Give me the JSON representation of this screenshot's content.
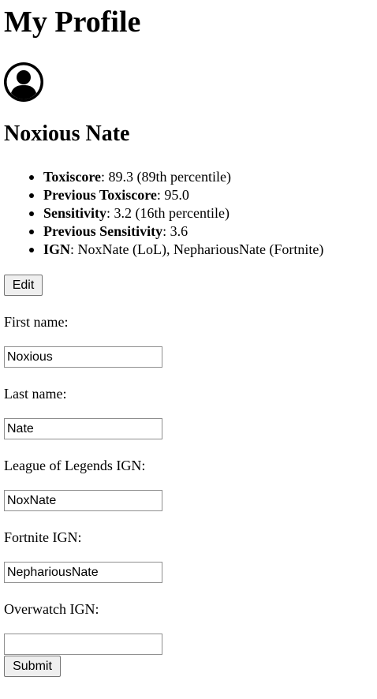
{
  "page": {
    "title": "My Profile"
  },
  "profile": {
    "avatar_icon": "user-avatar-icon",
    "name": "Noxious Nate"
  },
  "stats": [
    {
      "label": "Toxiscore",
      "value": ": 89.3 (89th percentile)"
    },
    {
      "label": "Previous Toxiscore",
      "value": ": 95.0"
    },
    {
      "label": "Sensitivity",
      "value": ": 3.2 (16th percentile)"
    },
    {
      "label": "Previous Sensitivity",
      "value": ": 3.6"
    },
    {
      "label": "IGN",
      "value": ": NoxNate (LoL), NephariousNate (Fortnite)"
    }
  ],
  "buttons": {
    "edit": "Edit",
    "submit": "Submit"
  },
  "form": {
    "first_name": {
      "label": "First name:",
      "value": "Noxious"
    },
    "last_name": {
      "label": "Last name:",
      "value": "Nate"
    },
    "lol_ign": {
      "label": "League of Legends IGN:",
      "value": "NoxNate"
    },
    "fortnite_ign": {
      "label": "Fortnite IGN:",
      "value": "NephariousNate"
    },
    "overwatch_ign": {
      "label": "Overwatch IGN:",
      "value": ""
    }
  }
}
